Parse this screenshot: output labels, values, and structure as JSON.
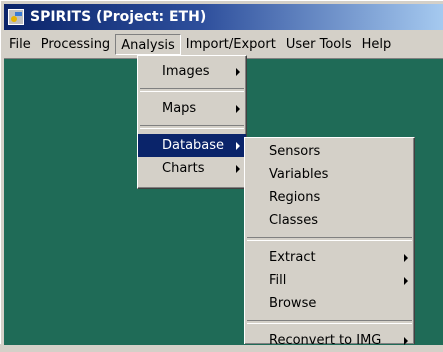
{
  "window": {
    "title": "SPIRITS (Project: ETH)"
  },
  "menubar": [
    "File",
    "Processing",
    "Analysis",
    "Import/Export",
    "User Tools",
    "Help"
  ],
  "analysis_menu": {
    "items": [
      "Images",
      "Maps",
      "Database",
      "Charts"
    ]
  },
  "database_menu": {
    "items": [
      "Sensors",
      "Variables",
      "Regions",
      "Classes",
      "Extract",
      "Fill",
      "Browse",
      "Reconvert to IMG"
    ]
  },
  "colors": {
    "desktop": "#1f6b57",
    "highlight": "#0a246a",
    "title_start": "#0a246a",
    "title_end": "#a6caf0",
    "face": "#d4d0c8"
  }
}
